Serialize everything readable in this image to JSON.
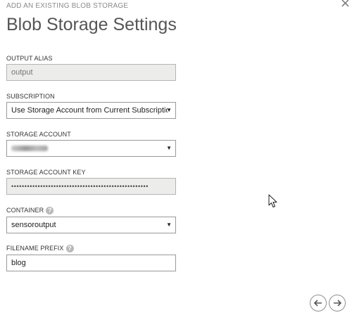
{
  "header": {
    "wizard_title": "ADD AN EXISTING BLOB STORAGE",
    "page_title": "Blob Storage Settings"
  },
  "form": {
    "output_alias": {
      "label": "OUTPUT ALIAS",
      "value": "output"
    },
    "subscription": {
      "label": "SUBSCRIPTION",
      "value": "Use Storage Account from Current Subscription"
    },
    "storage_account": {
      "label": "STORAGE ACCOUNT",
      "value_redacted": true
    },
    "storage_account_key": {
      "label": "STORAGE ACCOUNT KEY",
      "value": "••••••••••••••••••••••••••••••••••••••••••••••••••••"
    },
    "container": {
      "label": "CONTAINER",
      "value": "sensoroutput"
    },
    "filename_prefix": {
      "label": "FILENAME PREFIX",
      "value": "blog"
    }
  },
  "icons": {
    "close": "close-icon",
    "help": "help-icon",
    "dropdown": "dropdown-arrow-icon",
    "back": "back-arrow-icon",
    "next": "next-arrow-icon",
    "cursor": "mouse-cursor-icon"
  }
}
